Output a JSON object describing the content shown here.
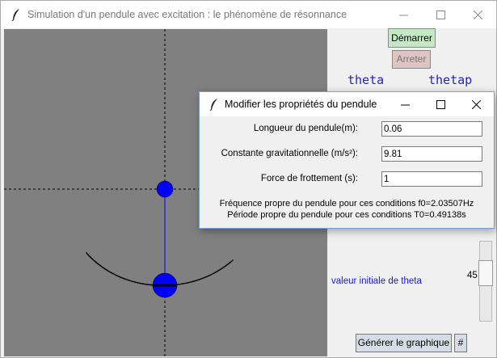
{
  "window": {
    "title": "Simulation d'un pendule avec excitation : le phénomène de résonnance",
    "minimize": "—",
    "maximize": "☐",
    "close": "✕"
  },
  "controls": {
    "start_label": "Démarrer",
    "stop_label": "Arreter",
    "theta_label": "theta",
    "thetap_label": "thetap",
    "init_theta_label": "valeur initiale de theta",
    "slider_value": "45",
    "generate_label": "Générer le graphique",
    "hash_label": "#"
  },
  "dialog": {
    "title": "Modifier les propriétés du pendule",
    "minimize": "—",
    "maximize": "☐",
    "close": "✕",
    "fields": [
      {
        "label": "Longueur du pendule(m):",
        "value": "0.06"
      },
      {
        "label": "Constante gravitationnelle (m/s²):",
        "value": "9.81"
      },
      {
        "label": "Force de frottement (s):",
        "value": "1"
      }
    ],
    "info_line1": "Fréquence propre du pendule pour ces conditions f0=2.03507Hz",
    "info_line2": "Période propre du pendule pour ces conditions T0=0.49138s"
  },
  "colors": {
    "canvas_bg": "#808080",
    "bob": "#0000ff",
    "trace": "#000000",
    "start_btn": "#c4e9c4",
    "stop_btn": "#e0c4c4",
    "label_blue": "#2222cc"
  },
  "icons": {
    "app": "feather-icon"
  }
}
